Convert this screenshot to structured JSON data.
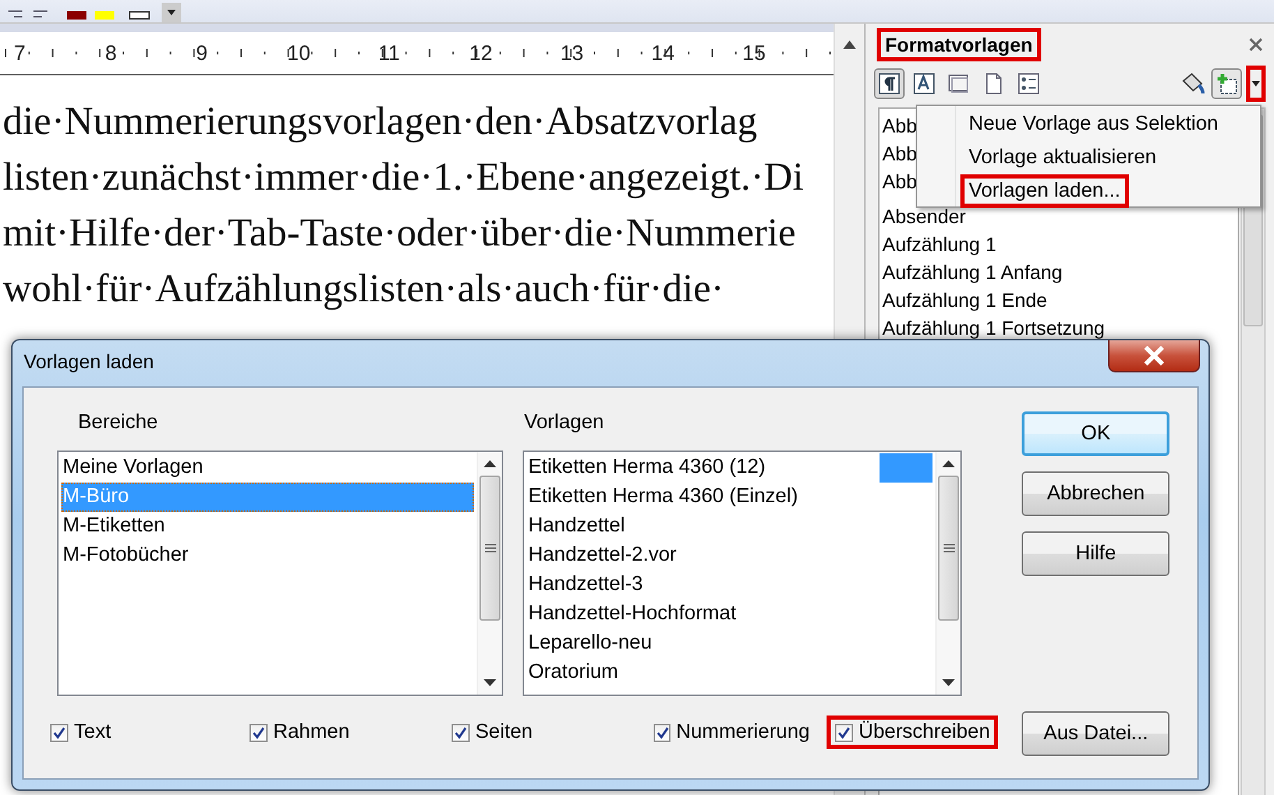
{
  "ruler": {
    "numbers": [
      "7",
      "8",
      "9",
      "10",
      "11",
      "12",
      "13",
      "14",
      "15"
    ]
  },
  "document": {
    "lines": [
      "die·Nummerierungsvorlagen·den·Absatzvorlag",
      "listen·zunächst·immer·die·1.·Ebene·angezeigt.·Di",
      "mit·Hilfe·der·Tab-Taste·oder·über·die·Nummerie",
      "wohl·für·Aufzählungslisten·als·auch·für·die·"
    ]
  },
  "sidebar": {
    "title": "Formatvorlagen",
    "title_highlighted": true,
    "menu_button_highlighted": true,
    "style_types": [
      {
        "kind": "paragraph",
        "selected": true
      },
      {
        "kind": "character",
        "selected": false
      },
      {
        "kind": "frame",
        "selected": false
      },
      {
        "kind": "page",
        "selected": false
      },
      {
        "kind": "list",
        "selected": false
      }
    ],
    "styles": [
      "Abb",
      "Abb",
      "Abb",
      "Absender",
      "Aufzählung 1",
      "Aufzählung 1 Anfang",
      "Aufzählung 1 Ende",
      "Aufzählung 1 Fortsetzung"
    ]
  },
  "context_menu": {
    "items": [
      {
        "label": "Neue Vorlage aus Selektion",
        "highlighted": false
      },
      {
        "label": "Vorlage aktualisieren",
        "highlighted": false
      },
      {
        "label": "Vorlagen laden...",
        "highlighted": true
      }
    ]
  },
  "dialog": {
    "title": "Vorlagen laden",
    "areas": {
      "label": "Bereiche",
      "items": [
        {
          "label": "Meine Vorlagen",
          "selected": false
        },
        {
          "label": "M-Büro",
          "selected": true
        },
        {
          "label": "M-Etiketten",
          "selected": false
        },
        {
          "label": "M-Fotobücher",
          "selected": false
        }
      ]
    },
    "templates": {
      "label": "Vorlagen",
      "items": [
        {
          "label": "Etiketten Herma 4360 (12)",
          "selected": true
        },
        {
          "label": "Etiketten Herma 4360 (Einzel)",
          "selected": false
        },
        {
          "label": "Handzettel",
          "selected": false
        },
        {
          "label": "Handzettel-2.vor",
          "selected": false
        },
        {
          "label": "Handzettel-3",
          "selected": false
        },
        {
          "label": "Handzettel-Hochformat",
          "selected": false
        },
        {
          "label": "Leparello-neu",
          "selected": false
        },
        {
          "label": "Oratorium",
          "selected": false
        }
      ]
    },
    "options": [
      {
        "label": "Text",
        "checked": true,
        "highlighted": false
      },
      {
        "label": "Rahmen",
        "checked": true,
        "highlighted": false
      },
      {
        "label": "Seiten",
        "checked": true,
        "highlighted": false
      },
      {
        "label": "Nummerierung",
        "checked": true,
        "highlighted": false
      },
      {
        "label": "Überschreiben",
        "checked": true,
        "highlighted": true
      }
    ],
    "buttons": [
      {
        "label": "OK",
        "kind": "default"
      },
      {
        "label": "Abbrechen",
        "kind": "normal"
      },
      {
        "label": "Hilfe",
        "kind": "normal"
      }
    ],
    "file_button": "Aus Datei..."
  }
}
